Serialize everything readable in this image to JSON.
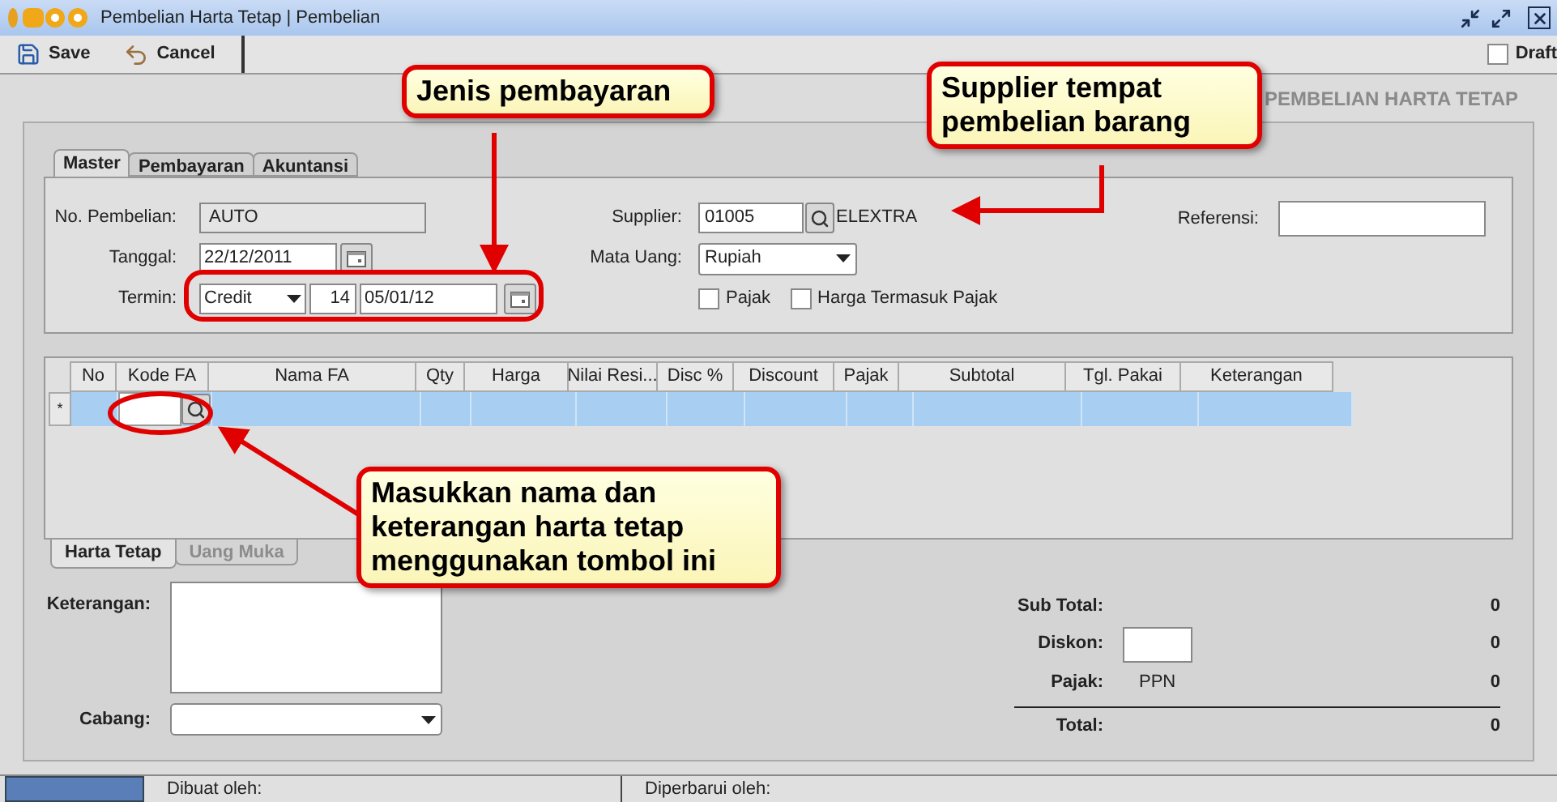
{
  "window": {
    "title": "Pembelian Harta Tetap | Pembelian"
  },
  "toolbar": {
    "buttons": [
      {
        "label": "Save",
        "kind": "save"
      },
      {
        "label": "Cancel",
        "kind": "cancel"
      }
    ],
    "draft": {
      "label": "Draft",
      "checked": false
    }
  },
  "heading": "PEMBELIAN HARTA TETAP",
  "tabs": [
    {
      "label": "Master",
      "selected": true
    },
    {
      "label": "Pembayaran",
      "selected": false
    },
    {
      "label": "Akuntansi",
      "selected": false
    }
  ],
  "master": {
    "no_pembelian": {
      "label": "No. Pembelian:",
      "value": "AUTO"
    },
    "tanggal": {
      "label": "Tanggal:",
      "value": "22/12/2011"
    },
    "termin": {
      "label": "Termin:",
      "type": "Credit",
      "days": "14",
      "due_date": "05/01/12"
    },
    "supplier": {
      "label": "Supplier:",
      "code": "01005",
      "name": "ELEXTRA"
    },
    "mata_uang": {
      "label": "Mata Uang:",
      "value": "Rupiah"
    },
    "pajak": {
      "label": "Pajak",
      "checked": false
    },
    "harga_termasuk_pajak": {
      "label": "Harga Termasuk Pajak",
      "checked": false
    },
    "referensi": {
      "label": "Referensi:"
    }
  },
  "table": {
    "columns": [
      "No",
      "Kode FA",
      "Nama FA",
      "Qty",
      "Harga",
      "Nilai Resi...",
      "Disc %",
      "Discount",
      "Pajak",
      "Subtotal",
      "Tgl. Pakai",
      "Keterangan"
    ],
    "rows": [
      {
        "marker": "*",
        "selected": true
      }
    ]
  },
  "bottom_tabs": [
    {
      "label": "Harta Tetap",
      "selected": true,
      "disabled": false
    },
    {
      "label": "Uang Muka",
      "selected": false,
      "disabled": true
    }
  ],
  "details": {
    "keterangan": {
      "label": "Keterangan:"
    },
    "cabang": {
      "label": "Cabang:"
    }
  },
  "totals": [
    {
      "label": "Sub Total:",
      "value": "0",
      "kind": "plain"
    },
    {
      "label": "Diskon:",
      "value": "0",
      "kind": "input"
    },
    {
      "label": "Pajak:",
      "note": "PPN",
      "value": "0",
      "kind": "note"
    },
    {
      "label": "Total:",
      "value": "0",
      "kind": "total"
    }
  ],
  "status_bar": {
    "created_by": "Dibuat oleh:",
    "updated_by": "Diperbarui oleh:"
  },
  "callouts": [
    {
      "text": "Jenis pembayaran"
    },
    {
      "text": "Supplier tempat pembelian barang"
    },
    {
      "text": "Masukkan nama dan keterangan harta tetap menggunakan tombol ini"
    }
  ]
}
